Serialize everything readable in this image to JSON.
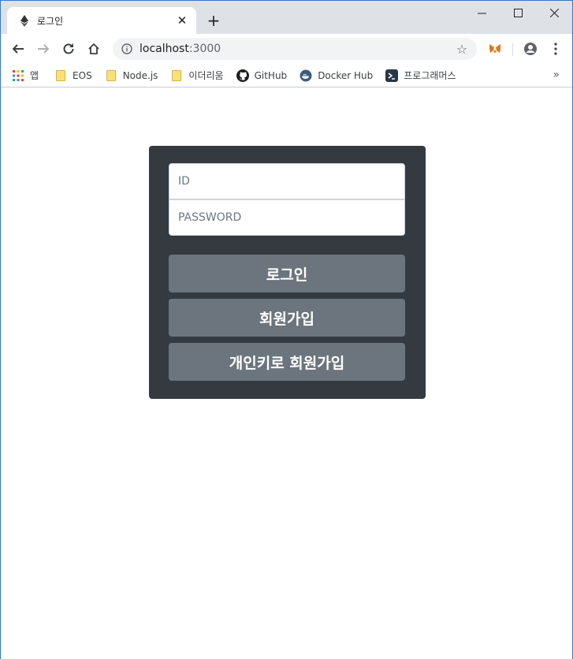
{
  "tab": {
    "title": "로그인",
    "favicon": "ethereum-icon"
  },
  "toolbar": {
    "url_host": "localhost",
    "url_port": ":3000"
  },
  "bookmarks": [
    {
      "label": "앱",
      "icon": "apps-grid-icon"
    },
    {
      "label": "EOS",
      "icon": "folder-icon"
    },
    {
      "label": "Node.js",
      "icon": "folder-icon"
    },
    {
      "label": "이더리움",
      "icon": "folder-icon"
    },
    {
      "label": "GitHub",
      "icon": "github-icon"
    },
    {
      "label": "Docker Hub",
      "icon": "docker-icon"
    },
    {
      "label": "프로그래머스",
      "icon": "programmers-icon"
    }
  ],
  "login": {
    "id_placeholder": "ID",
    "password_placeholder": "PASSWORD",
    "login_label": "로그인",
    "signup_label": "회원가입",
    "key_signup_label": "개인키로 회원가입"
  },
  "colors": {
    "panel": "#343a40",
    "button": "#6c757d",
    "tabstrip": "#dee1e6"
  }
}
